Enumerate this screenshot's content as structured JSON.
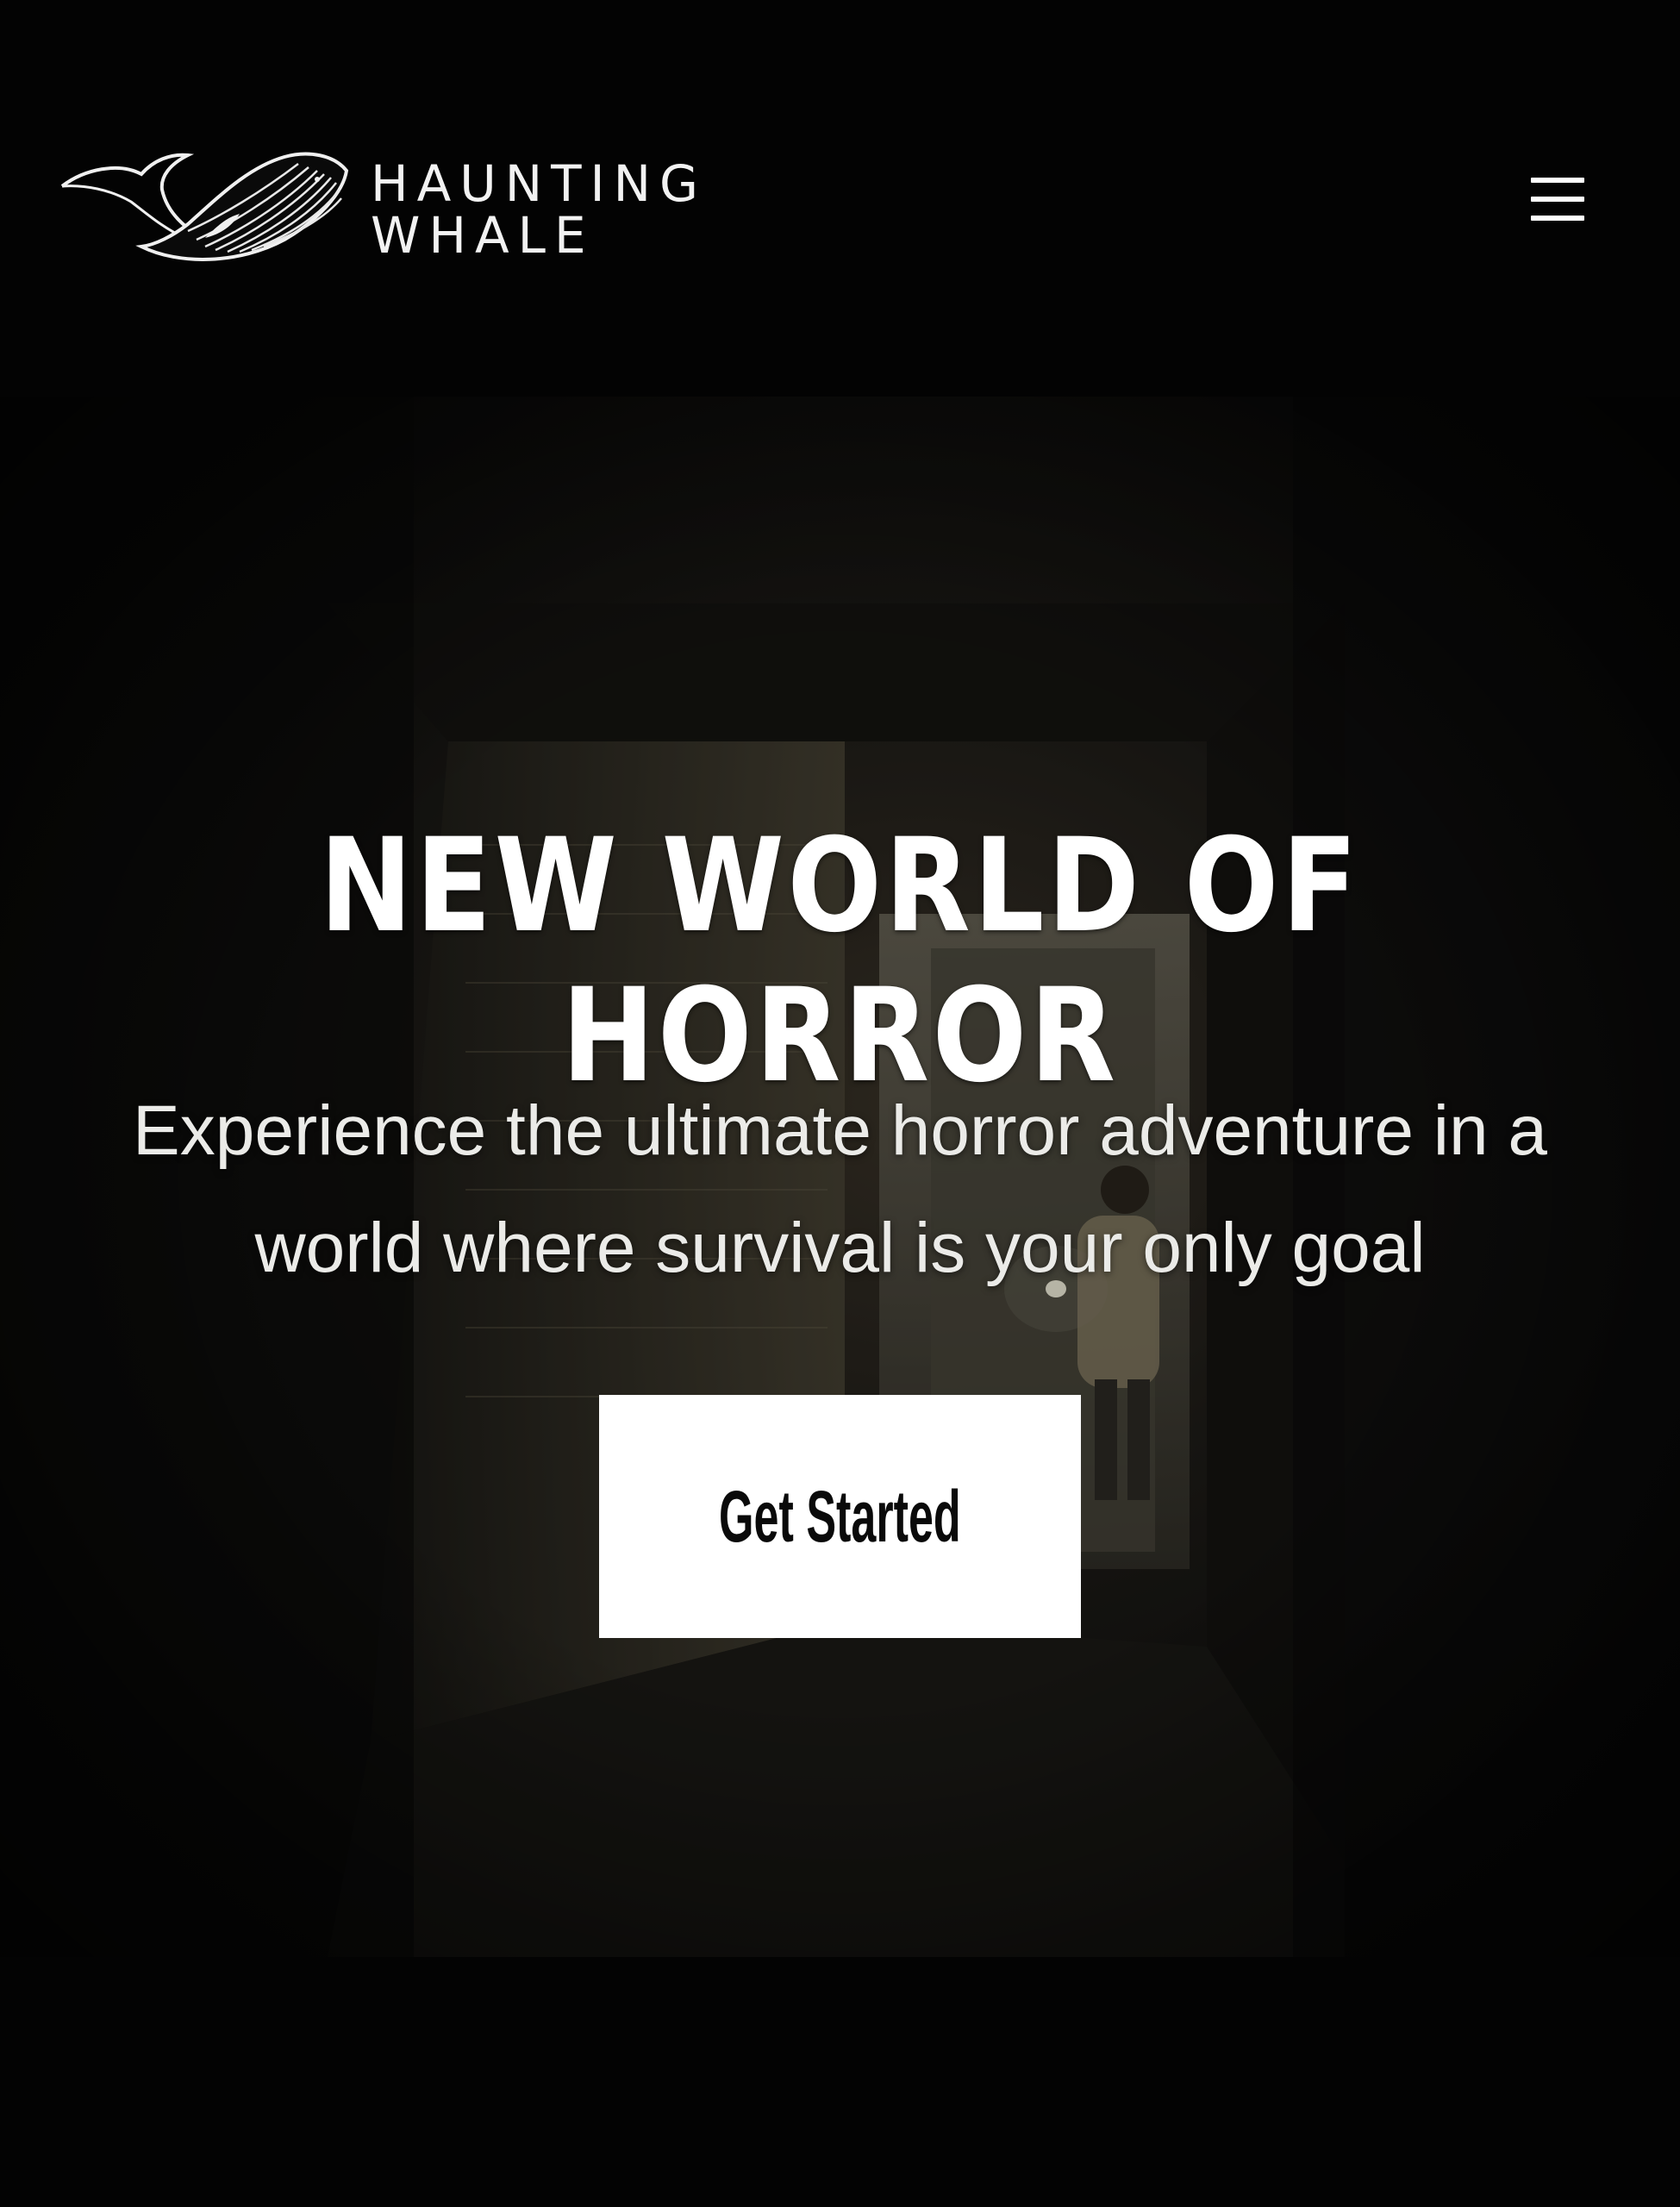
{
  "brand": {
    "line1": "HAUNTING",
    "line2": "WHALE",
    "logo_icon": "whale-icon"
  },
  "nav": {
    "menu_icon": "hamburger-menu-icon"
  },
  "hero": {
    "title": "NEW WORLD OF HORROR",
    "subtitle": "Experience the ultimate horror adventure in a world where survival is your only goal",
    "cta_label": "Get Started",
    "background": "dark abandoned corridor with person holding flashlight"
  },
  "colors": {
    "background": "#030303",
    "text": "#ffffff",
    "button_bg": "#ffffff",
    "button_text": "#0a0a0a"
  }
}
